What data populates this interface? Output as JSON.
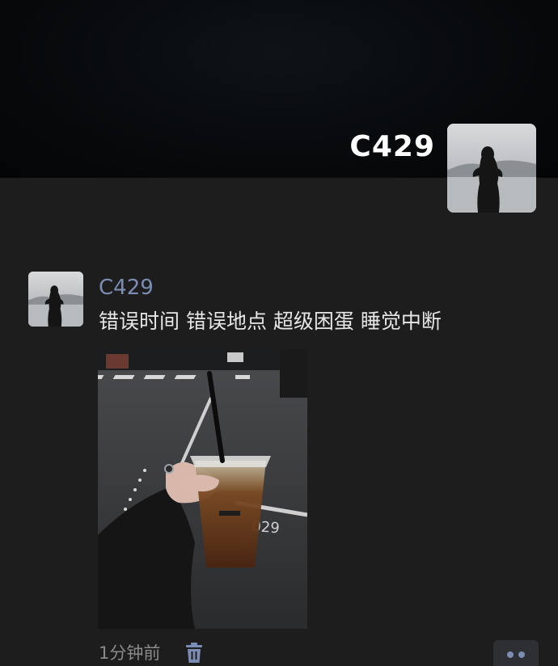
{
  "profile": {
    "name": "C429",
    "avatar_icon": "silhouette-avatar"
  },
  "post": {
    "author": "C429",
    "text": "错误时间 错误地点 超级困蛋 睡觉中断",
    "image_subject": "iced-coffee-photo",
    "time": "1分钟前",
    "delete_icon": "trash-icon",
    "more_icon": "more-dots-icon"
  },
  "colors": {
    "background": "#1d1d1d",
    "author_link": "#7c8db4",
    "text": "#e6e6e6",
    "muted": "#8a8a8a"
  }
}
